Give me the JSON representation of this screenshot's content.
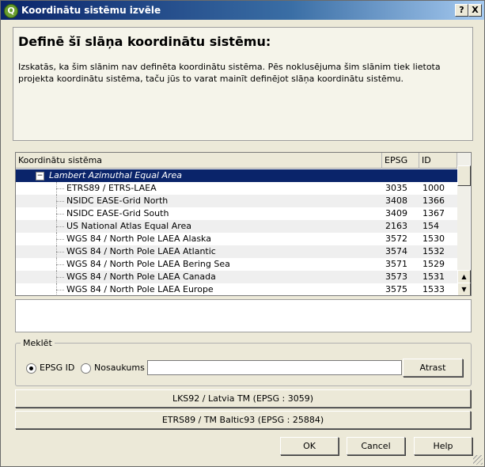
{
  "window": {
    "title": "Koordinātu sistēmu izvēle",
    "help_glyph": "?",
    "close_glyph": "X",
    "app_icon_glyph": "Q"
  },
  "header": {
    "title": "Definē šī slāņa koordinātu sistēmu:",
    "description": "Izskatās, ka šim slānim nav definēta koordinātu sistēma. Pēs noklusējuma šim slānim tiek lietota projekta koordinātu sistēma, taču jūs to varat mainīt definējot slāņa koordinātu sistēmu."
  },
  "tree": {
    "columns": [
      "Koordinātu sistēma",
      "EPSG",
      "ID"
    ],
    "group": {
      "label": "Lambert Azimuthal Equal Area",
      "toggle_glyph": "−"
    },
    "rows": [
      {
        "name": "ETRS89 / ETRS-LAEA",
        "epsg": "3035",
        "id": "1000"
      },
      {
        "name": "NSIDC EASE-Grid North",
        "epsg": "3408",
        "id": "1366"
      },
      {
        "name": "NSIDC EASE-Grid South",
        "epsg": "3409",
        "id": "1367"
      },
      {
        "name": "US National Atlas Equal Area",
        "epsg": "2163",
        "id": "154"
      },
      {
        "name": "WGS 84 / North Pole LAEA Alaska",
        "epsg": "3572",
        "id": "1530"
      },
      {
        "name": "WGS 84 / North Pole LAEA Atlantic",
        "epsg": "3574",
        "id": "1532"
      },
      {
        "name": "WGS 84 / North Pole LAEA Bering Sea",
        "epsg": "3571",
        "id": "1529"
      },
      {
        "name": "WGS 84 / North Pole LAEA Canada",
        "epsg": "3573",
        "id": "1531"
      },
      {
        "name": "WGS 84 / North Pole LAEA Europe",
        "epsg": "3575",
        "id": "1533"
      }
    ]
  },
  "search": {
    "group_label": "Meklēt",
    "radio_epsg_label": "EPSG ID",
    "radio_name_label": "Nosaukums",
    "selected": "EPSG ID",
    "input_value": "",
    "find_button": "Atrast"
  },
  "recent": [
    "LKS92 / Latvia TM (EPSG : 3059)",
    "ETRS89 / TM Baltic93 (EPSG : 25884)"
  ],
  "buttons": {
    "ok": "OK",
    "cancel": "Cancel",
    "help": "Help"
  },
  "colors": {
    "selection": "#0a246a",
    "titlebar": "#0a246a",
    "dialog_bg": "#ece9d8"
  }
}
